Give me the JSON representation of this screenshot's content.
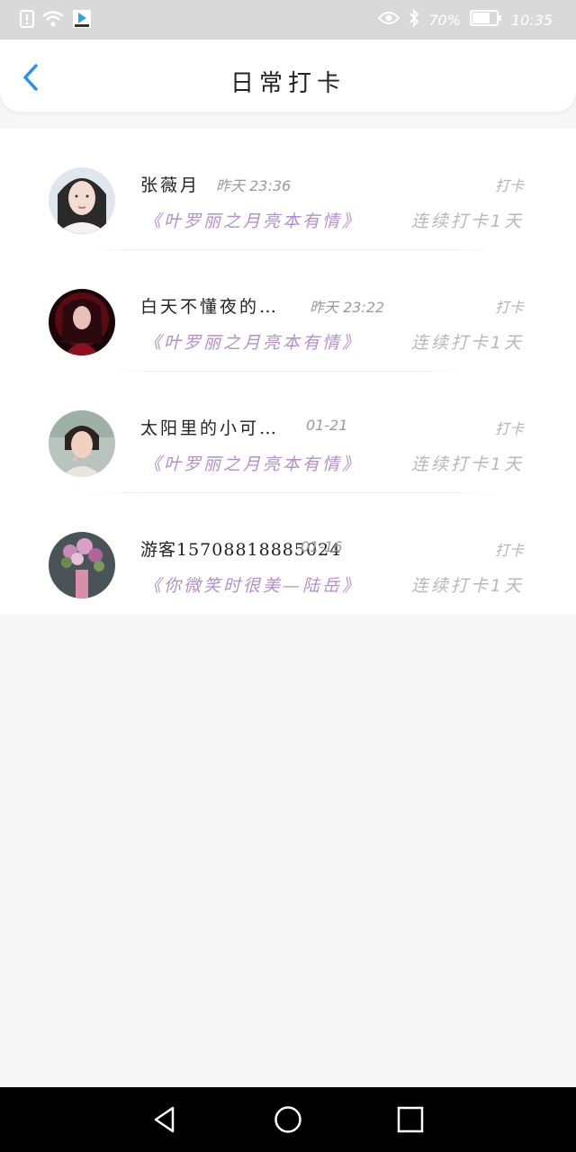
{
  "status_bar": {
    "battery": "70%",
    "time": "10:35",
    "icons": [
      "alert-icon",
      "wifi-icon",
      "app-badge-icon",
      "eye-icon",
      "bluetooth-icon",
      "battery-icon"
    ]
  },
  "header": {
    "title": "日常打卡",
    "back_icon": "chevron-left-icon"
  },
  "checkins": [
    {
      "name": "张薇月",
      "time": "昨天 23:36",
      "action": "打卡",
      "book": "《叶罗丽之月亮本有情》",
      "streak": "连续打卡1天"
    },
    {
      "name": "白天不懂夜的…",
      "time": "昨天 23:22",
      "action": "打卡",
      "book": "《叶罗丽之月亮本有情》",
      "streak": "连续打卡1天"
    },
    {
      "name": "太阳里的小可…",
      "time": "01-21",
      "action": "打卡",
      "book": "《叶罗丽之月亮本有情》",
      "streak": "连续打卡1天"
    },
    {
      "name": "游客15708818885024",
      "time": "01-16",
      "action": "打卡",
      "book": "《你微笑时很美—陆岳》",
      "streak": "连续打卡1天"
    }
  ],
  "nav": [
    "back-triangle-icon",
    "home-circle-icon",
    "recents-square-icon"
  ],
  "colors": {
    "accent": "#2b8ff0",
    "book": "#b48fcc",
    "muted": "#b8b8b8"
  }
}
